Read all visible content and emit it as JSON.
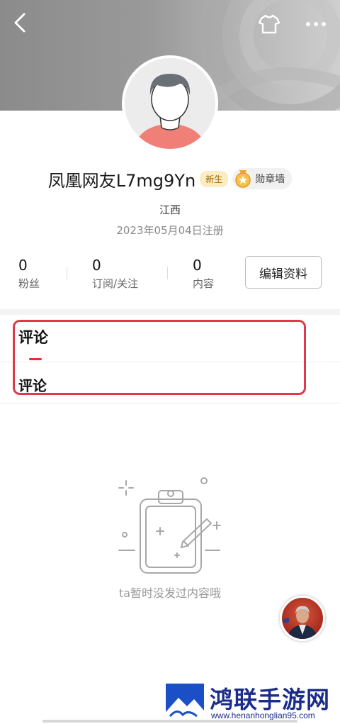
{
  "user": {
    "name": "凤凰网友L7mg9Yn",
    "new_badge": "新生",
    "medal_wall_label": "勋章墙",
    "location": "江西",
    "registered": "2023年05月04日注册"
  },
  "stats": [
    {
      "value": "0",
      "label": "粉丝"
    },
    {
      "value": "0",
      "label": "订阅/关注"
    },
    {
      "value": "0",
      "label": "内容"
    }
  ],
  "edit_profile_label": "编辑资料",
  "tab": {
    "label": "评论"
  },
  "section": {
    "label": "评论"
  },
  "empty_state": {
    "text": "ta暂时没发过内容哦"
  },
  "watermark": {
    "title": "鸿联手游网",
    "url": "www.henanhonglian95.com"
  },
  "icons": {
    "back": "back-arrow-icon",
    "theme": "tshirt-icon",
    "more": "more-dots-icon",
    "medal": "medal-icon"
  },
  "colors": {
    "accent_red": "#e23030",
    "highlight_box": "#e03a4a",
    "watermark_blue": "#1b2c8a",
    "badge_bg": "#fbecc2"
  }
}
